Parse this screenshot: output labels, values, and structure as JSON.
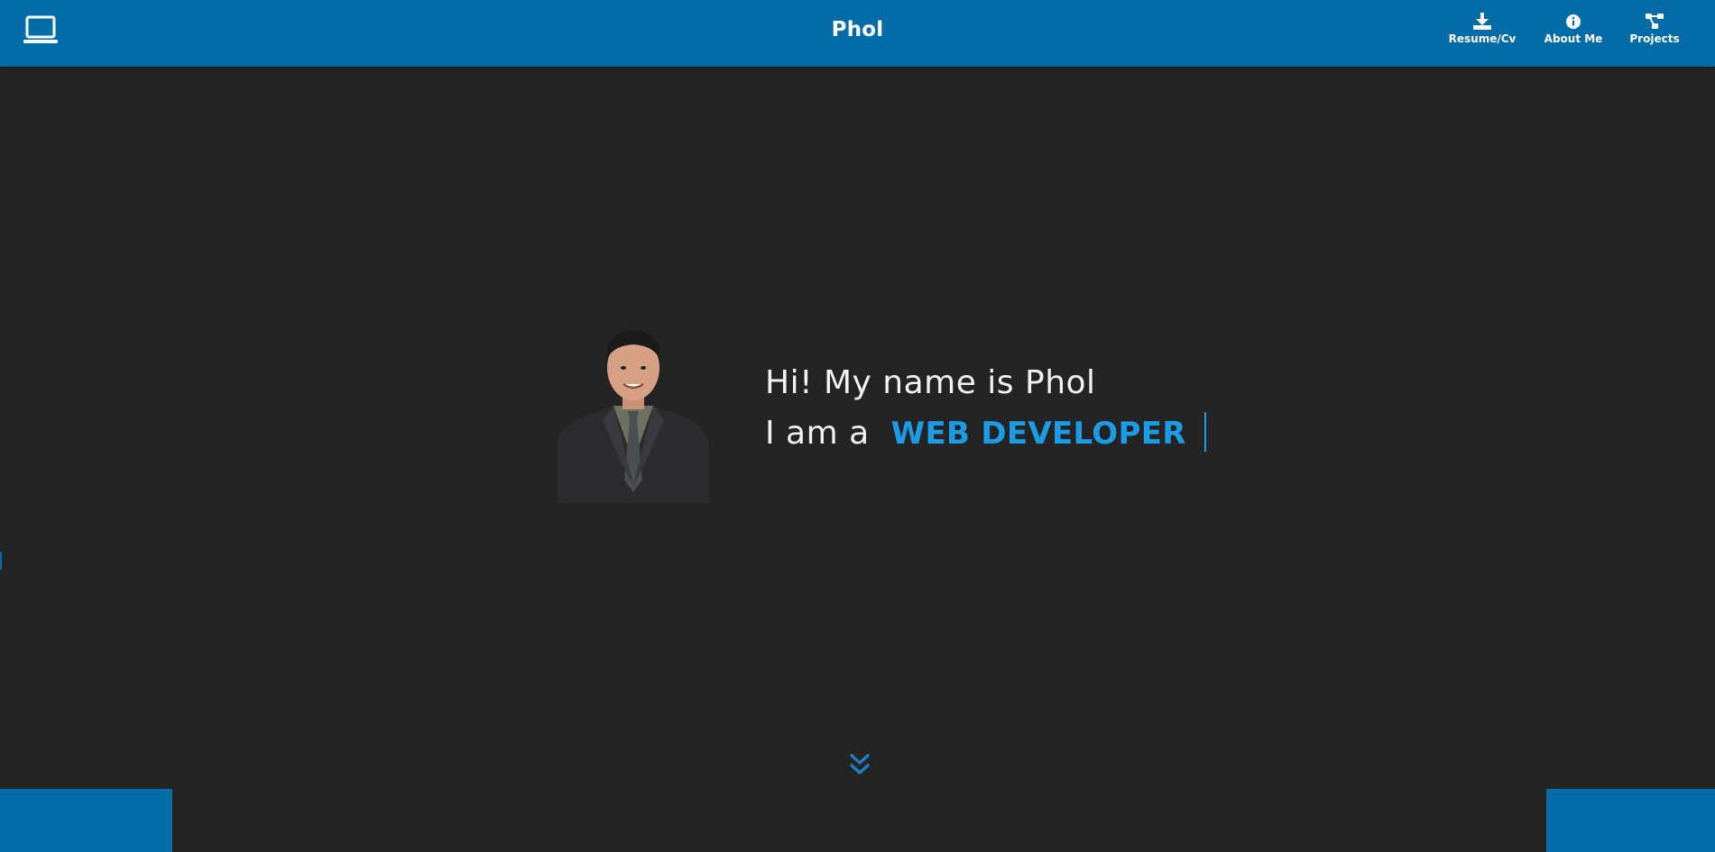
{
  "header": {
    "brand": "Phol",
    "logo_icon": "laptop-icon",
    "nav": [
      {
        "label": "Resume/Cv",
        "icon": "download-icon"
      },
      {
        "label": "About Me",
        "icon": "info-circle-icon"
      },
      {
        "label": "Projects",
        "icon": "project-diagram-icon"
      }
    ]
  },
  "hero": {
    "greeting": "Hi! My name is Phol",
    "role_prefix": "I am a",
    "role_value": "WEB DEVELOPER",
    "scroll_icon": "double-chevron-down-icon"
  },
  "colors": {
    "nav_bg": "#036ba6",
    "page_bg": "#242424",
    "accent": "#1d9ce6",
    "text": "#f2f2f2"
  }
}
